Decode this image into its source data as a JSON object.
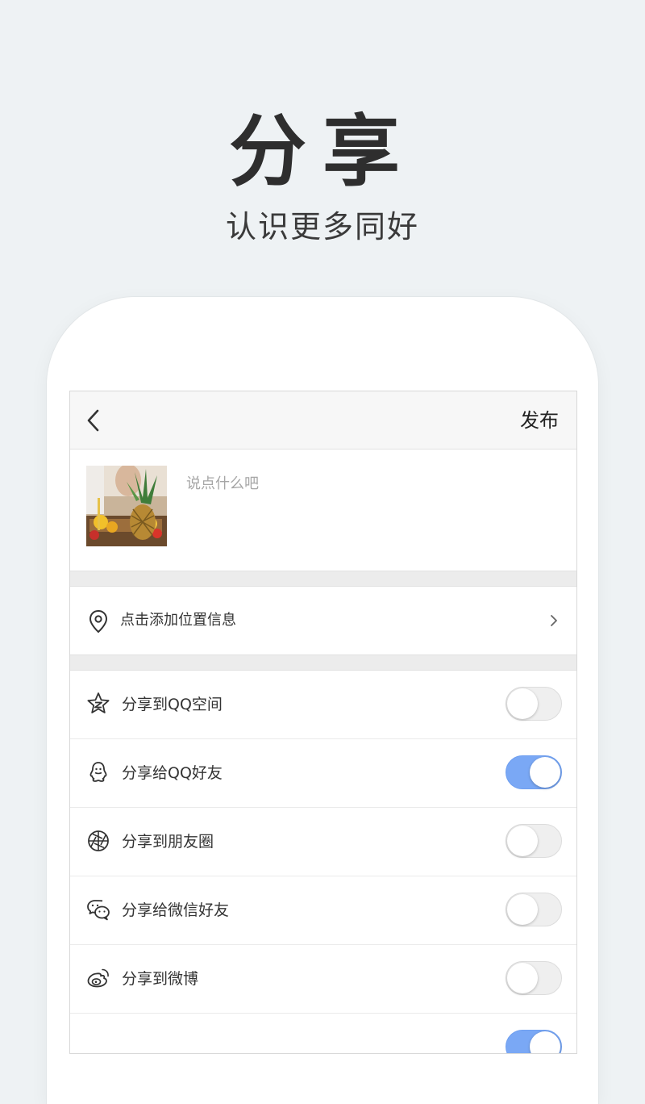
{
  "hero": {
    "title": "分享",
    "subtitle": "认识更多同好"
  },
  "nav": {
    "publish_label": "发布"
  },
  "compose": {
    "placeholder": "说点什么吧"
  },
  "location": {
    "label": "点击添加位置信息"
  },
  "share": {
    "items": [
      {
        "label": "分享到QQ空间",
        "icon": "qzone-icon",
        "enabled": false
      },
      {
        "label": "分享给QQ好友",
        "icon": "qq-icon",
        "enabled": true
      },
      {
        "label": "分享到朋友圈",
        "icon": "moments-icon",
        "enabled": false
      },
      {
        "label": "分享给微信好友",
        "icon": "wechat-icon",
        "enabled": false
      },
      {
        "label": "分享到微博",
        "icon": "weibo-icon",
        "enabled": false
      },
      {
        "label": "",
        "icon": "",
        "enabled": true
      }
    ]
  },
  "colors": {
    "accent": "#7aa8f5",
    "background": "#eef2f4"
  }
}
